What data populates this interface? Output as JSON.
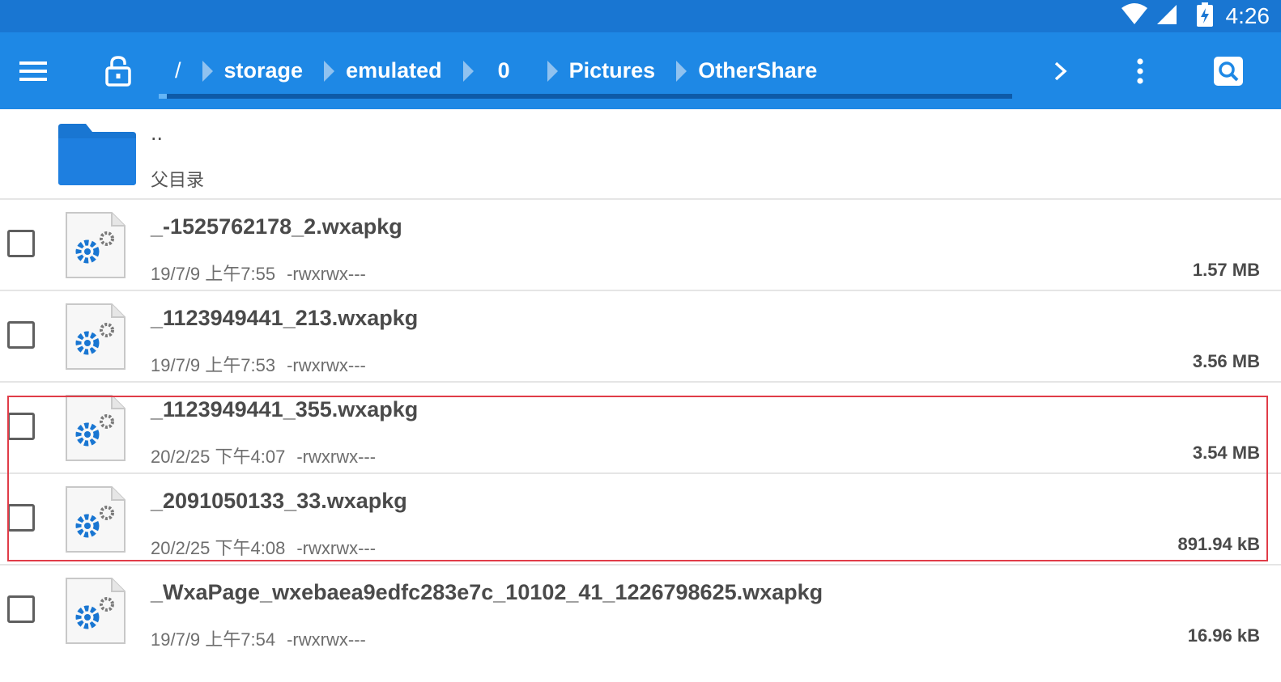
{
  "status_bar": {
    "time": "4:26",
    "icons": [
      "wifi-icon",
      "signal-icon",
      "battery-charging-icon"
    ]
  },
  "toolbar": {
    "menu_icon": "hamburger-menu-icon",
    "lock_icon": "lock-open-icon",
    "breadcrumb": [
      "/",
      "storage",
      "emulated",
      "0",
      "Pictures",
      "OtherShare"
    ],
    "next_icon": "chevron-right-icon",
    "more_icon": "more-vertical-icon",
    "search_icon": "search-icon",
    "colors": {
      "status_bar": "#1976d2",
      "toolbar": "#1e88e5"
    }
  },
  "list": {
    "parent": {
      "name": "..",
      "label": "父目录",
      "icon": "folder-icon"
    },
    "files": [
      {
        "name": "_-1525762178_2.wxapkg",
        "date": "19/7/9 上午7:55",
        "perms": "-rwxrwx---",
        "size": "1.57 MB",
        "icon": "settings-file-icon"
      },
      {
        "name": "_1123949441_213.wxapkg",
        "date": "19/7/9 上午7:53",
        "perms": "-rwxrwx---",
        "size": "3.56 MB",
        "icon": "settings-file-icon"
      },
      {
        "name": "_1123949441_355.wxapkg",
        "date": "20/2/25 下午4:07",
        "perms": "-rwxrwx---",
        "size": "3.54 MB",
        "icon": "settings-file-icon"
      },
      {
        "name": "_2091050133_33.wxapkg",
        "date": "20/2/25 下午4:08",
        "perms": "-rwxrwx---",
        "size": "891.94 kB",
        "icon": "settings-file-icon"
      },
      {
        "name": "_WxaPage_wxebaea9edfc283e7c_10102_41_1226798625.wxapkg",
        "date": "19/7/9 上午7:54",
        "perms": "-rwxrwx---",
        "size": "16.96 kB",
        "icon": "settings-file-icon"
      }
    ]
  },
  "annotation": {
    "highlight_color": "#e03c48"
  }
}
